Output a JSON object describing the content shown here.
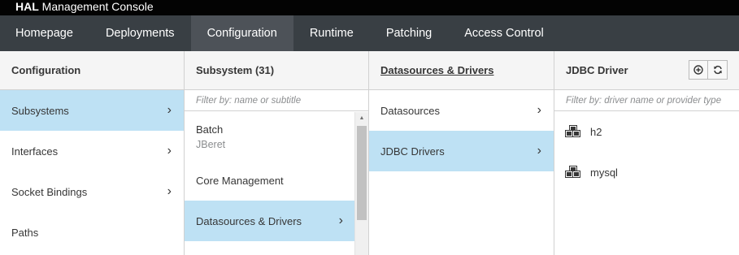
{
  "app": {
    "title_brand": "HAL",
    "title_rest": "Management Console"
  },
  "nav": {
    "items": [
      {
        "label": "Homepage"
      },
      {
        "label": "Deployments"
      },
      {
        "label": "Configuration"
      },
      {
        "label": "Runtime"
      },
      {
        "label": "Patching"
      },
      {
        "label": "Access Control"
      }
    ],
    "active": "Configuration"
  },
  "columns": {
    "configuration": {
      "title": "Configuration",
      "items": [
        {
          "label": "Subsystems",
          "active": true
        },
        {
          "label": "Interfaces"
        },
        {
          "label": "Socket Bindings"
        },
        {
          "label": "Paths"
        }
      ]
    },
    "subsystem": {
      "title": "Subsystem (31)",
      "filter_placeholder": "Filter by: name or subtitle",
      "items": [
        {
          "label": "Batch",
          "subtitle": "JBeret"
        },
        {
          "label": "Core Management"
        },
        {
          "label": "Datasources & Drivers",
          "active": true
        }
      ]
    },
    "datasources": {
      "title": "Datasources & Drivers",
      "items": [
        {
          "label": "Datasources"
        },
        {
          "label": "JDBC Drivers",
          "active": true
        }
      ]
    },
    "jdbc_driver": {
      "title": "JDBC Driver",
      "filter_placeholder": "Filter by: driver name or provider type",
      "items": [
        {
          "label": "h2",
          "icon": "cubes-icon"
        },
        {
          "label": "mysql",
          "icon": "cubes-icon"
        }
      ],
      "buttons": [
        {
          "icon": "add-circle-icon"
        },
        {
          "icon": "refresh-icon"
        }
      ]
    }
  },
  "colors": {
    "titlebar_bg": "#030303",
    "navbar_bg": "#393f44",
    "nav_active_bg": "#4d5258",
    "selected_row_bg": "#bee1f4",
    "header_bg": "#f5f5f5"
  }
}
